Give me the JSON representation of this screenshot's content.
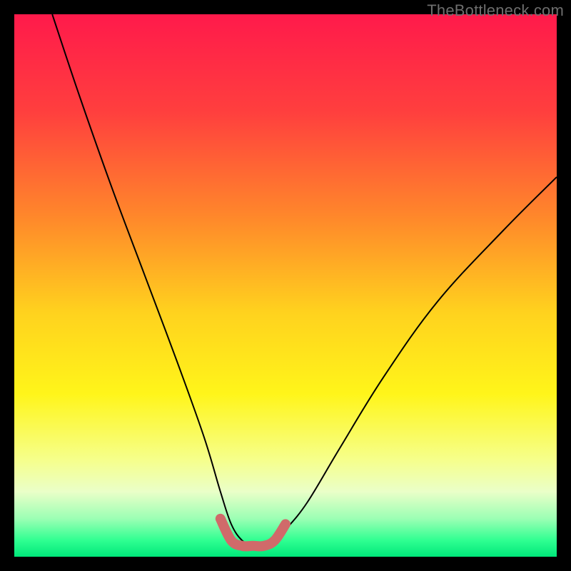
{
  "watermark": "TheBottleneck.com",
  "chart_data": {
    "type": "line",
    "title": "",
    "xlabel": "",
    "ylabel": "",
    "xlim": [
      0,
      100
    ],
    "ylim": [
      0,
      100
    ],
    "grid": false,
    "legend": false,
    "gradient_stops": [
      {
        "pct": 0,
        "color": "#ff1a4b"
      },
      {
        "pct": 18,
        "color": "#ff3f3e"
      },
      {
        "pct": 38,
        "color": "#ff8a2a"
      },
      {
        "pct": 55,
        "color": "#ffd21e"
      },
      {
        "pct": 70,
        "color": "#fff51a"
      },
      {
        "pct": 82,
        "color": "#f6ff8a"
      },
      {
        "pct": 88,
        "color": "#eaffc8"
      },
      {
        "pct": 93,
        "color": "#9bffb4"
      },
      {
        "pct": 97,
        "color": "#2fff91"
      },
      {
        "pct": 100,
        "color": "#00e77a"
      }
    ],
    "series": [
      {
        "name": "bottleneck-curve",
        "stroke": "#000000",
        "stroke_width": 2,
        "x": [
          7,
          12,
          18,
          24,
          30,
          35,
          38,
          40,
          42,
          44,
          46,
          48,
          50,
          54,
          60,
          68,
          78,
          90,
          100
        ],
        "y": [
          100,
          85,
          68,
          52,
          36,
          22,
          12,
          6,
          3,
          2,
          2,
          3,
          5,
          10,
          20,
          33,
          47,
          60,
          70
        ]
      },
      {
        "name": "optimal-range-marker",
        "stroke": "#d06a6a",
        "stroke_width": 14,
        "linecap": "round",
        "x": [
          38,
          40,
          42,
          44,
          46,
          48,
          50
        ],
        "y": [
          7,
          3,
          2,
          2,
          2,
          3,
          6
        ]
      }
    ]
  }
}
